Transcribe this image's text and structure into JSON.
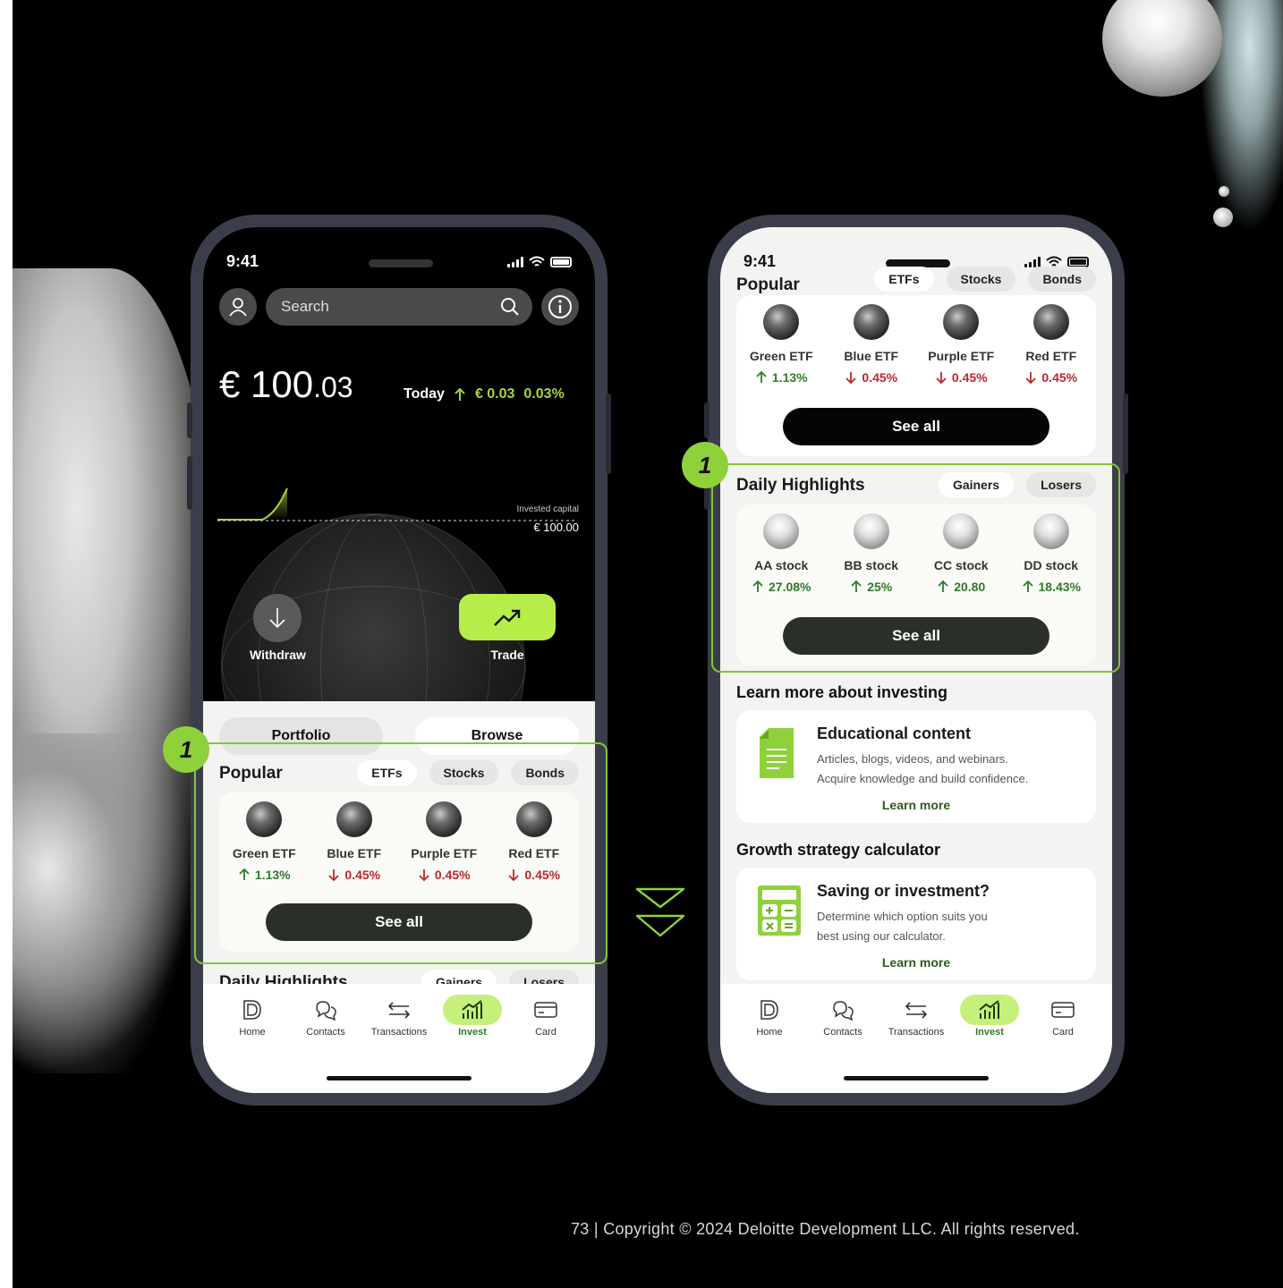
{
  "colors": {
    "accent": "#b6ed48",
    "highlight_border": "#86c23a",
    "up": "#2f7a2a",
    "down": "#c0262b"
  },
  "phone1": {
    "time": "9:41",
    "search_placeholder": "Search",
    "balance_main": "€ 100",
    "balance_cents": ".03",
    "today_label": "Today",
    "today_abs": "€ 0.03",
    "today_pct": "0.03%",
    "invested_label": "Invested capital",
    "invested_value": "€ 100.00",
    "withdraw_label": "Withdraw",
    "trade_label": "Trade",
    "segments": {
      "portfolio": "Portfolio",
      "browse": "Browse"
    },
    "popular": {
      "title": "Popular",
      "chips": [
        "ETFs",
        "Stocks",
        "Bonds"
      ],
      "items": [
        {
          "name": "Green ETF",
          "change": "1.13%",
          "dir": "up"
        },
        {
          "name": "Blue ETF",
          "change": "0.45%",
          "dir": "down"
        },
        {
          "name": "Purple ETF",
          "change": "0.45%",
          "dir": "down"
        },
        {
          "name": "Red ETF",
          "change": "0.45%",
          "dir": "down"
        }
      ],
      "see_all": "See all"
    },
    "daily": {
      "title": "Daily Highlights",
      "chips": [
        "Gainers",
        "Losers"
      ]
    },
    "badge": "1"
  },
  "phone2": {
    "time": "9:41",
    "popular": {
      "title": "Popular",
      "chips": [
        "ETFs",
        "Stocks",
        "Bonds"
      ],
      "items": [
        {
          "name": "Green ETF",
          "change": "1.13%",
          "dir": "up"
        },
        {
          "name": "Blue ETF",
          "change": "0.45%",
          "dir": "down"
        },
        {
          "name": "Purple ETF",
          "change": "0.45%",
          "dir": "down"
        },
        {
          "name": "Red ETF",
          "change": "0.45%",
          "dir": "down"
        }
      ],
      "see_all": "See all"
    },
    "daily": {
      "title": "Daily Highlights",
      "chips": [
        "Gainers",
        "Losers"
      ],
      "items": [
        {
          "name": "AA stock",
          "change": "27.08%"
        },
        {
          "name": "BB stock",
          "change": "25%"
        },
        {
          "name": "CC stock",
          "change": "20.80"
        },
        {
          "name": "DD stock",
          "change": "18.43%"
        }
      ],
      "see_all": "See all"
    },
    "badge": "1",
    "learn_title": "Learn more about investing",
    "edu": {
      "title": "Educational content",
      "desc1": "Articles, blogs, videos, and webinars.",
      "desc2": "Acquire knowledge and build confidence.",
      "link": "Learn more"
    },
    "growth_title": "Growth strategy calculator",
    "calc": {
      "title": "Saving or investment?",
      "desc1": "Determine which option suits you",
      "desc2": "best using our calculator.",
      "link": "Learn more"
    }
  },
  "tabbar": [
    {
      "label": "Home",
      "icon": "deloitte-d-icon"
    },
    {
      "label": "Contacts",
      "icon": "chat-bubbles-icon"
    },
    {
      "label": "Transactions",
      "icon": "transfer-arrows-icon"
    },
    {
      "label": "Invest",
      "icon": "invest-chart-icon",
      "active": true
    },
    {
      "label": "Card",
      "icon": "credit-card-icon"
    }
  ],
  "footer": "73 | Copyright © 2024 Deloitte Development LLC. All rights reserved."
}
